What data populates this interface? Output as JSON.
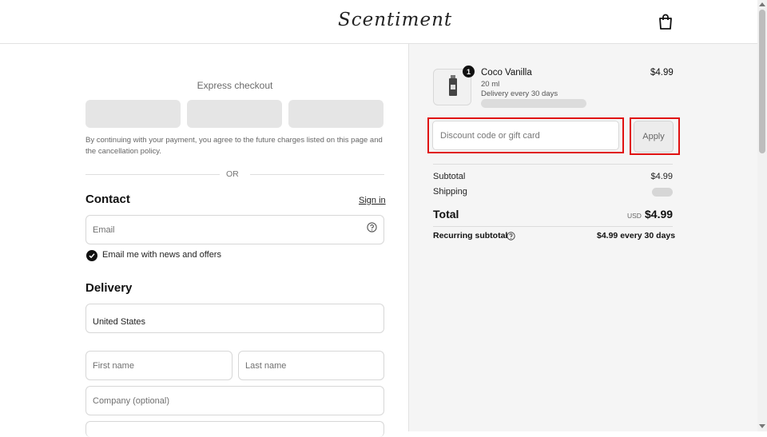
{
  "header": {
    "logo_text": "Scentiment",
    "cart_icon": "shopping-bag-icon"
  },
  "express": {
    "title": "Express checkout",
    "consent": "By continuing with your payment, you agree to the future charges listed on this page and the cancellation policy.",
    "divider_text": "OR"
  },
  "contact": {
    "title": "Contact",
    "signin_label": "Sign in",
    "email_placeholder": "Email",
    "news_checkbox_label": "Email me with news and offers"
  },
  "delivery": {
    "title": "Delivery",
    "country_value": "United States",
    "first_name_placeholder": "First name",
    "last_name_placeholder": "Last name",
    "company_placeholder": "Company (optional)"
  },
  "summary": {
    "item": {
      "quantity": "1",
      "name": "Coco Vanilla",
      "size": "20 ml",
      "delivery": "Delivery every 30 days",
      "price": "$4.99"
    },
    "discount_placeholder": "Discount code or gift card",
    "apply_label": "Apply",
    "subtotal_label": "Subtotal",
    "subtotal_value": "$4.99",
    "shipping_label": "Shipping",
    "total_label": "Total",
    "currency": "USD",
    "total_value": "$4.99",
    "recurring_label": "Recurring subtotal",
    "recurring_value": "$4.99 every 30 days"
  },
  "colors": {
    "highlight": "#e01111",
    "background_right": "#f5f5f5"
  }
}
